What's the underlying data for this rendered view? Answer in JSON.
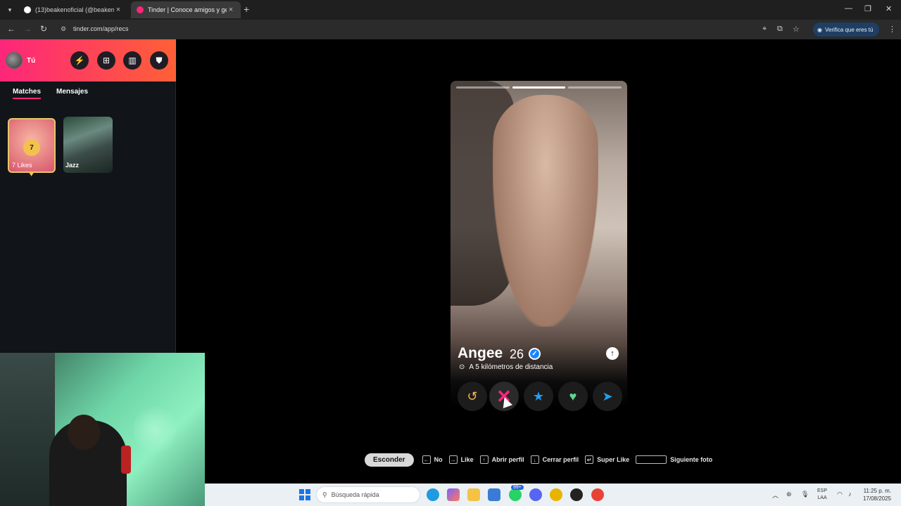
{
  "browser": {
    "tabs": [
      {
        "title": "(13)beakenoficial (@beakenofic",
        "favicon_color": "#111111"
      },
      {
        "title": "Tinder | Conoce amigos y gente",
        "favicon_color": "#fd267a"
      }
    ],
    "new_tab": "+",
    "url": "tinder.com/app/recs",
    "verify_label": "Verifica que eres tú",
    "window_controls": {
      "minimize": "—",
      "maximize": "❐",
      "close": "✕"
    }
  },
  "sidebar": {
    "profile_label": "Tú",
    "tabs": [
      {
        "label": "Matches",
        "active": true
      },
      {
        "label": "Mensajes",
        "active": false
      }
    ],
    "likes_card": {
      "count": "7",
      "label": "7 Likes"
    },
    "matches": [
      {
        "name": "Jazz"
      }
    ],
    "header_icons": [
      "boost-icon",
      "explore-icon",
      "gift-icon",
      "shield-icon"
    ]
  },
  "profile": {
    "name": "Angee",
    "age": "26",
    "verified": true,
    "distance": "A 5 kilómetros de distancia",
    "photo_count": 3,
    "current_photo": 2
  },
  "actions": [
    "rewind",
    "nope",
    "super-like",
    "like",
    "boost"
  ],
  "hints": {
    "hide_label": "Esconder",
    "items": [
      {
        "key": "←",
        "label": "No"
      },
      {
        "key": "→",
        "label": "Like"
      },
      {
        "key": "↑",
        "label": "Abrir perfil"
      },
      {
        "key": "↓",
        "label": "Cerrar perfil"
      },
      {
        "key": "↵",
        "label": "Super Like"
      },
      {
        "key": "",
        "label": "Siguiente foto"
      }
    ]
  },
  "taskbar": {
    "search_placeholder": "Búsqueda rápida",
    "notification_badge": "99+",
    "lang_line1": "ESP",
    "lang_line2": "LAA",
    "time": "11:25 p. m.",
    "date": "17/08/2025"
  }
}
